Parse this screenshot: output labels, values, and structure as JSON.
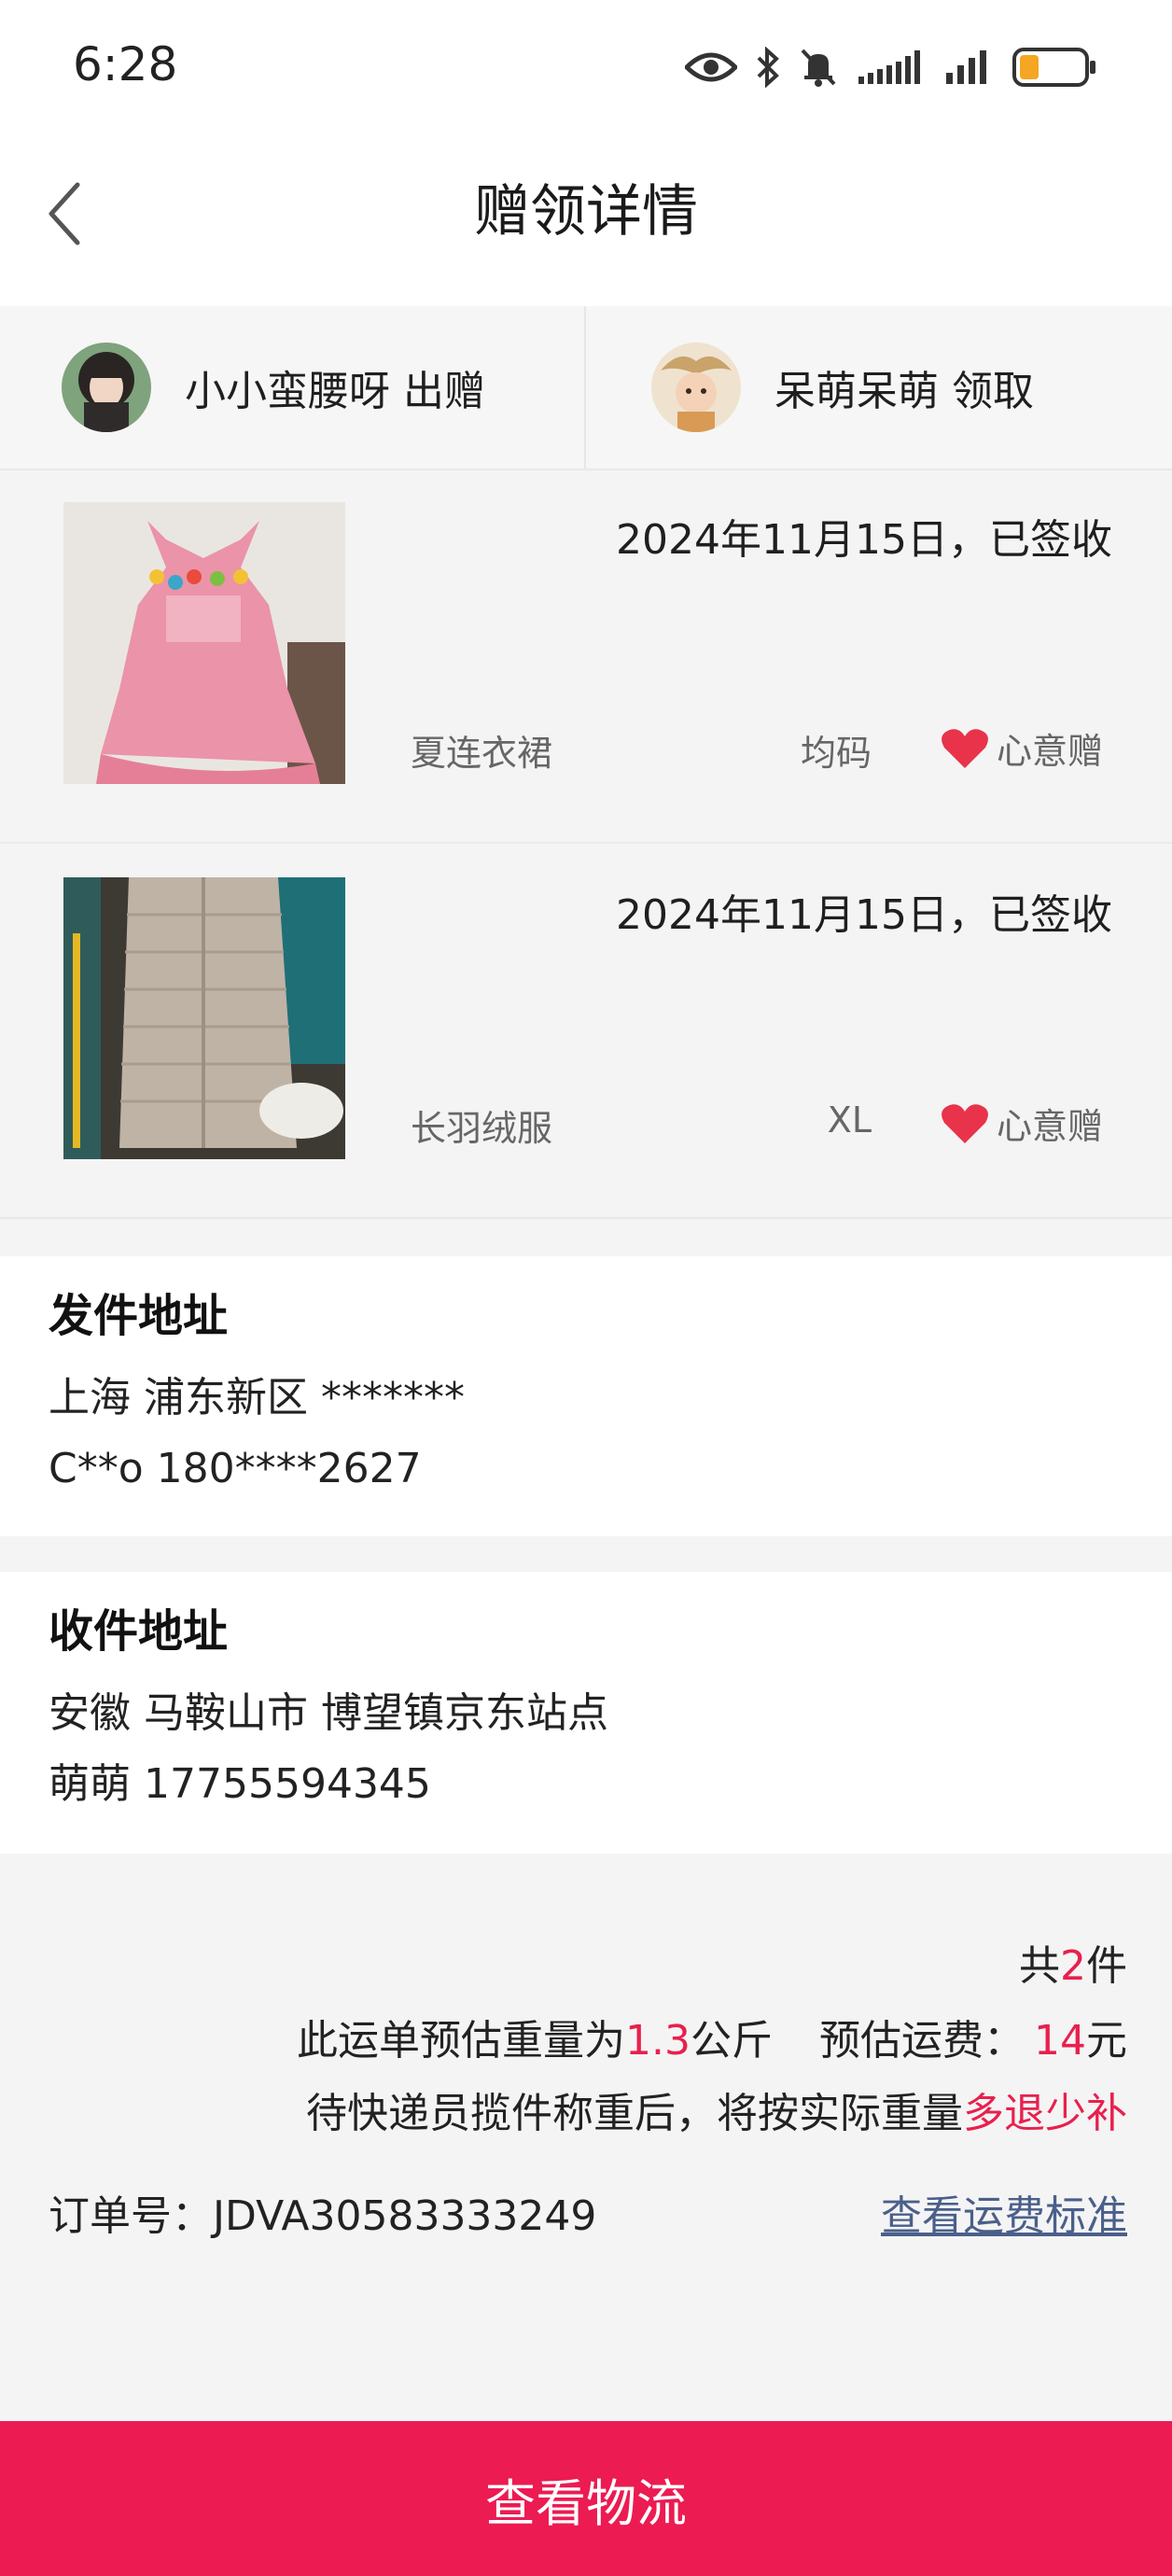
{
  "status_bar": {
    "time": "6:28",
    "icons": [
      "eye-icon",
      "bluetooth-icon",
      "mute-icon",
      "signal-icon",
      "signal-icon",
      "battery-icon"
    ]
  },
  "header": {
    "title": "赠领详情",
    "back_icon": "chevron-left-icon"
  },
  "parties": {
    "giver": "小小蛮腰呀 出赠",
    "receiver": "呆萌呆萌 领取"
  },
  "items": [
    {
      "date_status": "2024年11月15日，已签收",
      "name": "夏连衣裙",
      "size": "均码",
      "tag": "心意赠"
    },
    {
      "date_status": "2024年11月15日，已签收",
      "name": "长羽绒服",
      "size": "XL",
      "tag": "心意赠"
    }
  ],
  "sender": {
    "title": "发件地址",
    "address": "上海 浦东新区 *******",
    "contact": "C**o 180****2627"
  },
  "receiver_addr": {
    "title": "收件地址",
    "address": "安徽 马鞍山市 博望镇京东站点",
    "contact": "萌萌 17755594345"
  },
  "summary": {
    "count_prefix": "共",
    "count": "2",
    "count_suffix": "件",
    "weight_prefix": "此运单预估重量为",
    "weight": "1.3",
    "weight_unit": "公斤",
    "fee_prefix": "预估运费：",
    "fee": "14",
    "fee_unit": "元",
    "note_prefix": "待快递员揽件称重后，将按实际重量",
    "note_highlight": "多退少补",
    "order_label": "订单号：",
    "order_no": "JDVA30583333249",
    "fee_standard_link": "查看运费标准"
  },
  "bottom_button": "查看物流",
  "colors": {
    "accent": "#ec1b52",
    "highlight": "#e8204d",
    "link": "#4a5f8a",
    "heart": "#e8334a"
  }
}
